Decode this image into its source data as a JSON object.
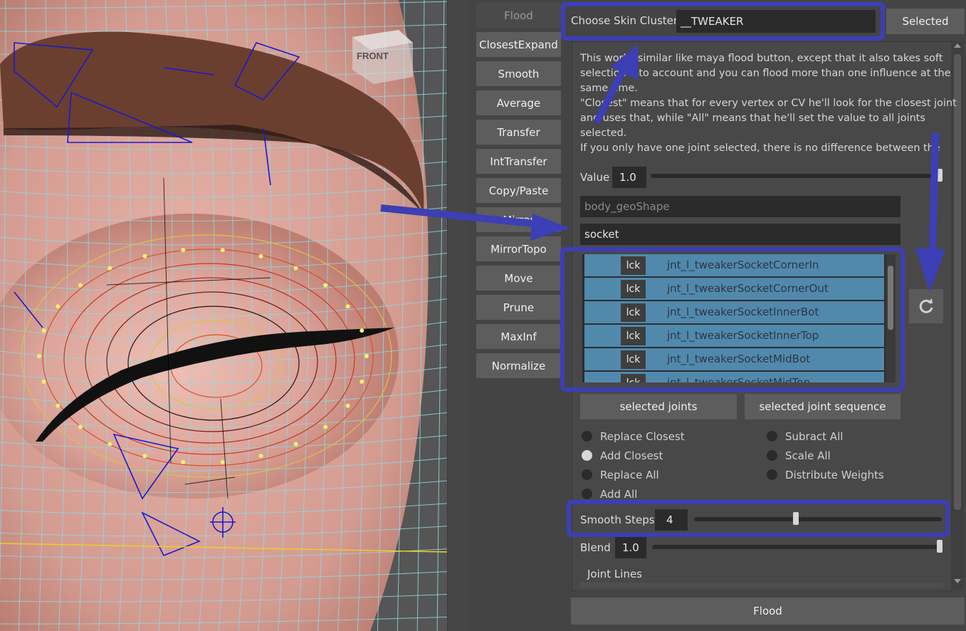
{
  "viewport": {
    "view_cube_label": "FRONT"
  },
  "tools": {
    "header": "Flood",
    "buttons": [
      "ClosestExpand",
      "Smooth",
      "Average",
      "Transfer",
      "IntTransfer",
      "Copy/Paste",
      "Mirror",
      "MirrorTopo",
      "Move",
      "Prune",
      "MaxInf",
      "Normalize"
    ]
  },
  "panel": {
    "choose_cluster_label": "Choose Skin Cluster",
    "cluster_value": "__TWEAKER",
    "selected_button": "Selected",
    "description": [
      "This works similar like maya flood button, except that it also takes soft",
      "selection into account and you can flood more than one influence at the",
      "same time.",
      "\"Closest\" means that for every vertex or CV he'll look for the closest joint",
      "and uses that, while \"All\" means that he'll set the value to all joints",
      "selected.",
      "If you only have one joint selected, there is no difference between the two"
    ],
    "value_label": "Value",
    "value": "1.0",
    "value_fraction": 1.0,
    "mesh_placeholder": "body_geoShape",
    "filter_value": "socket",
    "joints": [
      {
        "lock": "lck",
        "name": "jnt_l_tweakerSocketCornerIn"
      },
      {
        "lock": "lck",
        "name": "jnt_l_tweakerSocketCornerOut"
      },
      {
        "lock": "lck",
        "name": "jnt_l_tweakerSocketInnerBot"
      },
      {
        "lock": "lck",
        "name": "jnt_l_tweakerSocketInnerTop"
      },
      {
        "lock": "lck",
        "name": "jnt_l_tweakerSocketMidBot"
      },
      {
        "lock": "lck",
        "name": "jnt_l_tweakerSocketMidTop"
      }
    ],
    "selected_joints_button": "selected joints",
    "selected_joint_sequence_button": "selected joint sequence",
    "modes_left": [
      "Replace Closest",
      "Add Closest",
      "Replace All",
      "Add All"
    ],
    "modes_right": [
      "Subract All",
      "Scale All",
      "Distribute Weights"
    ],
    "active_mode": "Add Closest",
    "smooth_steps_label": "Smooth Steps",
    "smooth_steps_value": "4",
    "smooth_steps_fraction": 0.41,
    "blend_label": "Blend",
    "blend_value": "1.0",
    "blend_fraction": 1.0,
    "joint_lines_label": "Joint Lines",
    "flood_button": "Flood"
  },
  "colors": {
    "panel_bg": "#444444",
    "field_bg": "#2b2b2b",
    "joint_row": "#5189ad",
    "annotation": "#3c3fb5",
    "skin": "#d8a39a",
    "eyelash": "#111111",
    "brow": "#6b3f2f"
  }
}
